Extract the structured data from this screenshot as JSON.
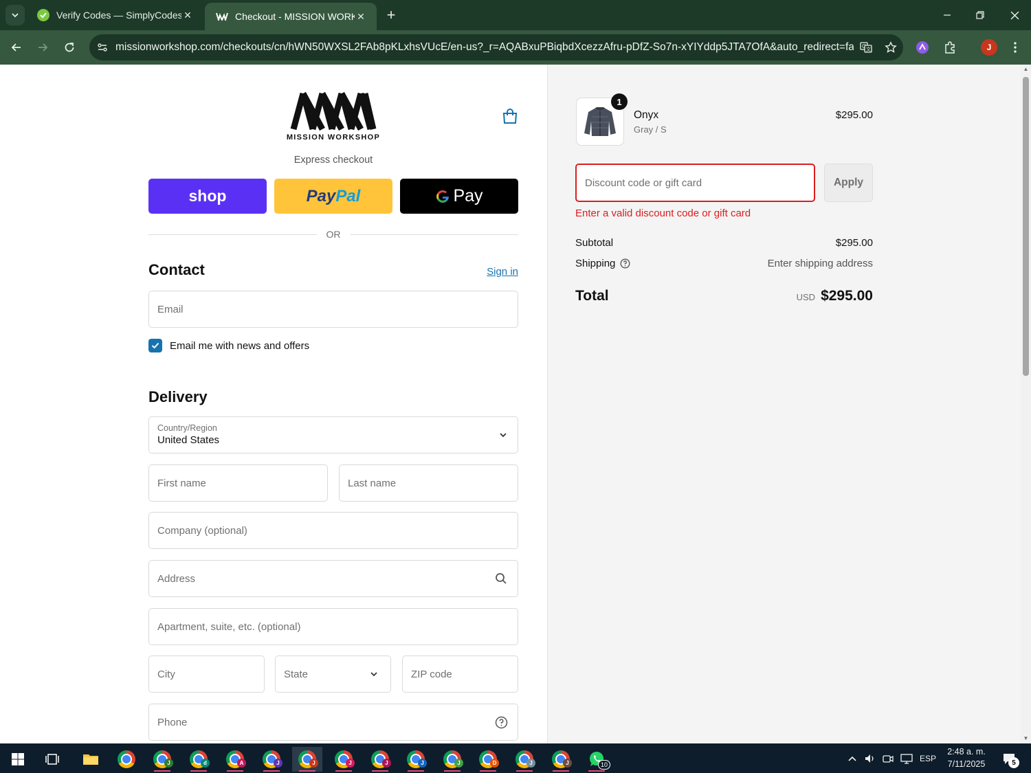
{
  "browser": {
    "tabs": [
      {
        "title": "Verify Codes — SimplyCodes",
        "active": false
      },
      {
        "title": "Checkout - MISSION WORKSHOP",
        "active": true
      }
    ],
    "url": "missionworkshop.com/checkouts/cn/hWN50WXSL2FAb8pKLxhsVUcE/en-us?_r=AQABxuPBiqbdXcezzAfru-pDfZ-So7n-xYIYddp5JTA7OfA&auto_redirect=false&s...",
    "profile_initial": "J",
    "accent_color": "#35583f"
  },
  "header": {
    "brand": "MISSION WORKSHOP"
  },
  "express": {
    "label": "Express checkout",
    "shop_label": "shop",
    "paypal_part1": "Pay",
    "paypal_part2": "Pal",
    "gpay_label": "Pay",
    "or_label": "OR"
  },
  "contact": {
    "heading": "Contact",
    "signin_label": "Sign in",
    "email_placeholder": "Email",
    "newsletter_label": "Email me with news and offers",
    "newsletter_checked": true
  },
  "delivery": {
    "heading": "Delivery",
    "country_label": "Country/Region",
    "country_value": "United States",
    "first_name_placeholder": "First name",
    "last_name_placeholder": "Last name",
    "company_placeholder": "Company (optional)",
    "address_placeholder": "Address",
    "apartment_placeholder": "Apartment, suite, etc. (optional)",
    "city_placeholder": "City",
    "state_placeholder": "State",
    "zip_placeholder": "ZIP code",
    "phone_placeholder": "Phone"
  },
  "summary": {
    "item": {
      "quantity": "1",
      "name": "Onyx",
      "variant": "Gray / S",
      "price": "$295.00"
    },
    "discount_placeholder": "Discount code or gift card",
    "apply_label": "Apply",
    "discount_error": "Enter a valid discount code or gift card",
    "subtotal_label": "Subtotal",
    "subtotal_value": "$295.00",
    "shipping_label": "Shipping",
    "shipping_value": "Enter shipping address",
    "total_label": "Total",
    "currency": "USD",
    "total_value": "$295.00",
    "error_color": "#dd1d1d",
    "link_color": "#1773b0"
  },
  "taskbar": {
    "language": "ESP",
    "time": "2:48 a. m.",
    "date": "7/11/2025",
    "whatsapp_count": "10",
    "notification_count": "5"
  }
}
